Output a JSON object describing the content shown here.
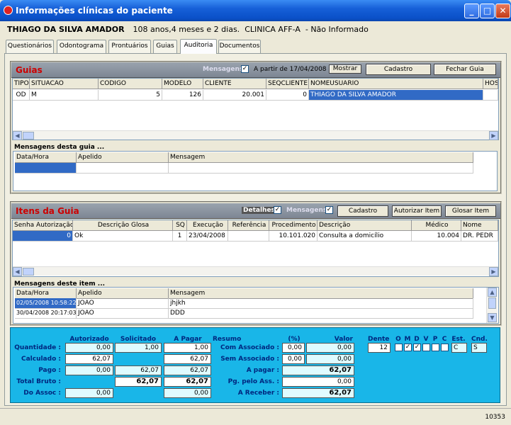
{
  "window": {
    "title": "Informações clínicas do paciente",
    "min": "_",
    "max": "□",
    "close": "✕"
  },
  "patient": {
    "name": "THIAGO DA SILVA AMADOR",
    "age": "108 anos,4 meses e 2 dias.",
    "clinic": "CLINICA  AFF-A",
    "info": "- Não Informado"
  },
  "tabs": [
    "Questionários",
    "Odontograma",
    "Prontuários",
    "Guias",
    "Auditoria",
    "Documentos"
  ],
  "guias": {
    "title": "Guias",
    "mensagens": "Mensagens",
    "mensagens_checked": true,
    "a_partir": "A partir de 17/04/2008",
    "mostrar": "Mostrar",
    "cadastro": "Cadastro",
    "fechar": "Fechar Guia",
    "columns": [
      "TIPO",
      "SITUACAO",
      "CODIGO",
      "MODELO",
      "CLIENTE",
      "SEQCLIENTE",
      "NOMEUSUARIO",
      "HOS"
    ],
    "rows": [
      [
        "OD",
        "M",
        "5",
        "126",
        "20.001",
        "0",
        "THIAGO DA SILVA AMADOR",
        ""
      ]
    ],
    "msg_title": "Mensagens desta guia ...",
    "msg_columns": [
      "Data/Hora",
      "Apelido",
      "Mensagem"
    ]
  },
  "itens": {
    "title": "Itens da Guia",
    "detalhes": "Detalhes",
    "mensagens": "Mensagens",
    "cadastro": "Cadastro",
    "autorizar": "Autorizar Item",
    "glosar": "Glosar Item",
    "columns": [
      "Senha Autorização",
      "Descrição Glosa",
      "SQ",
      "Execução",
      "Referência",
      "Procedimento",
      "Descrição",
      "Médico",
      "Nome"
    ],
    "rows": [
      [
        "0",
        "Ok",
        "1",
        "23/04/2008",
        "",
        "10.101.020",
        "Consulta a domicílio",
        "10.004",
        "DR. PEDR"
      ]
    ],
    "msg_title": "Mensagens deste item ...",
    "msg_columns": [
      "Data/Hora",
      "Apelido",
      "Mensagem"
    ],
    "msg_rows": [
      [
        "02/05/2008 10:58:22",
        "JOAO",
        "jhjkh"
      ],
      [
        "30/04/2008 20:17:03",
        "JOAO",
        "DDD"
      ]
    ]
  },
  "summary": {
    "headers": [
      "Autorizado",
      "Solicitado",
      "A Pagar"
    ],
    "rows": [
      {
        "label": "Quantidade :",
        "a": "0,00",
        "s": "1,00",
        "p": "1,00"
      },
      {
        "label": "Calculado :",
        "a": "62,07",
        "s": "",
        "p": "62,07"
      },
      {
        "label": "Pago :",
        "a": "0,00",
        "s": "62,07",
        "p": "62,07"
      },
      {
        "label": "Total Bruto :",
        "a": "",
        "s": "62,07",
        "p": "62,07"
      },
      {
        "label": "Do Assoc :",
        "a": "0,00",
        "s": "",
        "p": "0,00"
      }
    ],
    "resumo_title": "Resumo",
    "pct_title": "(%)",
    "valor_title": "Valor",
    "resumo": [
      {
        "label": "Com Associado :",
        "pct": "0,00",
        "valor": "0,00"
      },
      {
        "label": "Sem Associado :",
        "pct": "0,00",
        "valor": "0,00"
      },
      {
        "label": "A pagar :",
        "pct": "",
        "valor": "62,07"
      },
      {
        "label": "Pg. pelo Ass. :",
        "pct": "",
        "valor": "0,00"
      },
      {
        "label": "A Receber :",
        "pct": "",
        "valor": "62,07"
      }
    ],
    "dente_label": "Dente",
    "dente": "12",
    "faces": [
      "O",
      "M",
      "D",
      "V",
      "P",
      "C"
    ],
    "faces_checked": [
      false,
      true,
      true,
      false,
      false,
      false
    ],
    "est_label": "Est.",
    "est": "C",
    "cnd_label": "Cnd.",
    "cnd": "S"
  },
  "status": {
    "code": "10353"
  }
}
